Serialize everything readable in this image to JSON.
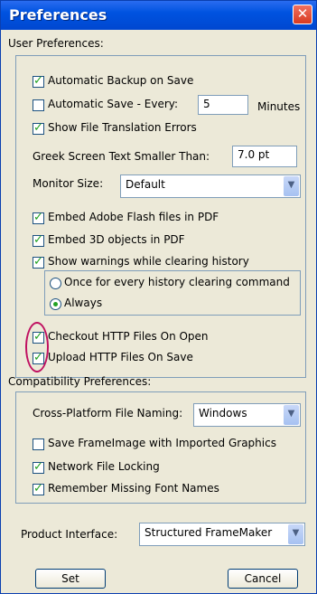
{
  "window": {
    "title": "Preferences",
    "close_glyph": "✕"
  },
  "user_prefs": {
    "group_label": "User Preferences:",
    "auto_backup": {
      "label": "Automatic Backup on Save",
      "checked": true
    },
    "auto_save": {
      "label": "Automatic Save - Every:",
      "checked": false,
      "value": "5",
      "unit": "Minutes"
    },
    "show_file_translation_errors": {
      "label": "Show File Translation Errors",
      "checked": true
    },
    "greek_text": {
      "label": "Greek Screen Text Smaller Than:",
      "value": "7.0 pt"
    },
    "monitor_size": {
      "label": "Monitor Size:",
      "selected": "Default"
    },
    "embed_flash": {
      "label": "Embed Adobe Flash files in PDF",
      "checked": true
    },
    "embed_3d": {
      "label": "Embed 3D objects in PDF",
      "checked": true
    },
    "show_warnings": {
      "label": "Show warnings while clearing history",
      "checked": true
    },
    "history_options": [
      {
        "label": "Once for every history clearing command",
        "selected": false
      },
      {
        "label": "Always",
        "selected": true
      }
    ],
    "checkout_http": {
      "label": "Checkout HTTP Files On Open",
      "checked": true
    },
    "upload_http": {
      "label": "Upload HTTP Files On Save",
      "checked": true
    }
  },
  "compat_prefs": {
    "group_label": "Compatibility Preferences:",
    "cross_platform": {
      "label": "Cross-Platform File Naming:",
      "selected": "Windows"
    },
    "save_frameimage": {
      "label": "Save FrameImage with Imported Graphics",
      "checked": false
    },
    "network_locking": {
      "label": "Network File Locking",
      "checked": true
    },
    "remember_fonts": {
      "label": "Remember Missing Font Names",
      "checked": true
    }
  },
  "product_interface": {
    "label": "Product Interface:",
    "selected": "Structured FrameMaker"
  },
  "buttons": {
    "set": "Set",
    "cancel": "Cancel"
  },
  "colors": {
    "titlebar": "#0053e0",
    "dialog_bg": "#ece9d8",
    "highlight_circle": "#c01060",
    "check_green": "#21a121"
  }
}
